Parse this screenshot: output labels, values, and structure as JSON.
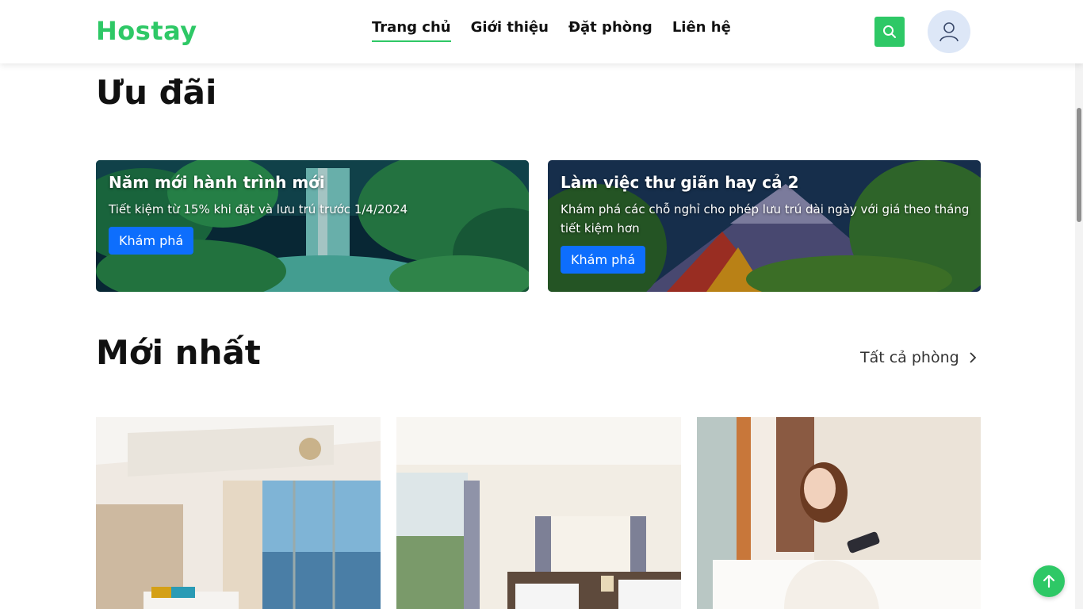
{
  "header": {
    "logo": "Hostay",
    "nav": [
      {
        "label": "Trang chủ",
        "active": true
      },
      {
        "label": "Giới thiệu",
        "active": false
      },
      {
        "label": "Đặt phòng",
        "active": false
      },
      {
        "label": "Liên hệ",
        "active": false
      }
    ],
    "search_icon": "search-icon",
    "avatar_icon": "user-avatar-icon"
  },
  "offers": {
    "title": "Ưu đãi",
    "cards": [
      {
        "title": "Năm mới hành trình mới",
        "description": "Tiết kiệm từ 15% khi đặt và lưu trú trước 1/4/2024",
        "button": "Khám phá"
      },
      {
        "title": "Làm việc thư giãn hay cả 2",
        "description": "Khám phá các chỗ nghỉ cho phép lưu trú dài ngày với giá theo tháng tiết kiệm hơn",
        "button": "Khám phá"
      }
    ]
  },
  "latest": {
    "title": "Mới nhất",
    "all_link": "Tất cả phòng",
    "rooms": [
      {
        "image": "bedroom-sea-view"
      },
      {
        "image": "twin-bedroom"
      },
      {
        "image": "woman-on-bed"
      }
    ]
  },
  "colors": {
    "accent": "#2ec866",
    "button_blue": "#0d6efd"
  },
  "fab_icon": "arrow-up-icon"
}
